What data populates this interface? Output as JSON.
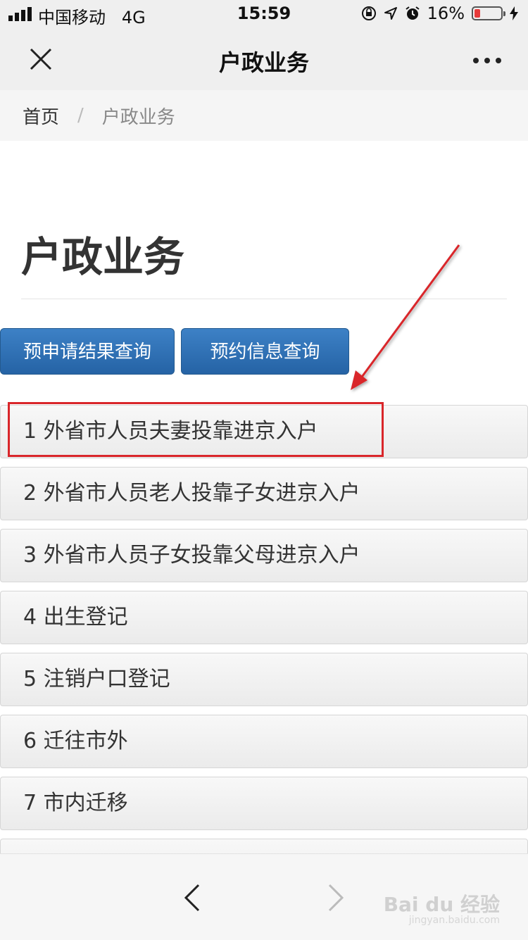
{
  "status": {
    "carrier": "中国移动",
    "network": "4G",
    "time": "15:59",
    "battery": "16%",
    "battery_color": "#e63a3a"
  },
  "nav": {
    "title": "户政业务"
  },
  "breadcrumb": {
    "home": "首页",
    "separator": "/",
    "current": "户政业务"
  },
  "page": {
    "heading": "户政业务"
  },
  "buttons": {
    "query_results": "预申请结果查询",
    "query_appointments": "预约信息查询",
    "accent": "#2e6fb3"
  },
  "list": {
    "items": [
      {
        "label": "1 外省市人员夫妻投靠进京入户"
      },
      {
        "label": "2 外省市人员老人投靠子女进京入户"
      },
      {
        "label": "3 外省市人员子女投靠父母进京入户"
      },
      {
        "label": "4 出生登记"
      },
      {
        "label": "5 注销户口登记"
      },
      {
        "label": "6 迁往市外"
      },
      {
        "label": "7 市内迁移"
      },
      {
        "label": ""
      }
    ]
  },
  "annotation": {
    "color": "#d9262a"
  },
  "watermark": {
    "text": "Bai du 经验",
    "sub": "jingyan.baidu.com"
  }
}
